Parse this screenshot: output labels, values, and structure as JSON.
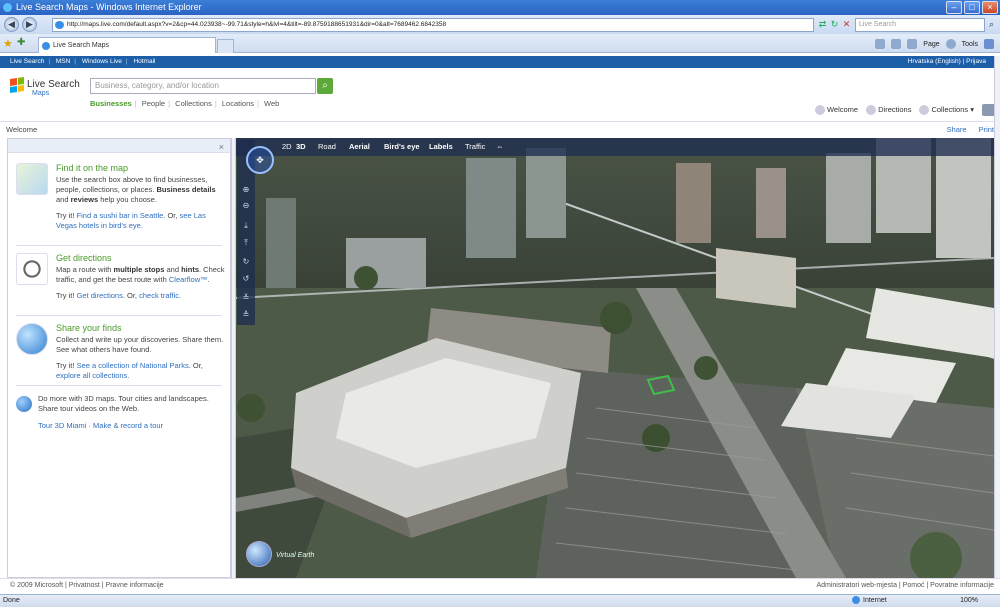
{
  "window": {
    "title": "Live Search Maps - Windows Internet Explorer"
  },
  "address": {
    "url": "http://maps.live.com/default.aspx?v=2&cp=44.023938~-99.71&style=h&lvl=4&tilt=-89.8759188651931&dir=0&alt=7689462.6842358"
  },
  "ie_search": {
    "placeholder": "Live Search"
  },
  "tab": {
    "title": "Live Search Maps"
  },
  "commandbar": {
    "page": "Page",
    "tools": "Tools"
  },
  "toplinks": {
    "items": [
      "Live Search",
      "MSN",
      "Windows Live",
      "Hotmail"
    ],
    "right": "Hrvatska (English) | Prijava"
  },
  "logo": {
    "line1": "Live Search",
    "line2": "Maps"
  },
  "search": {
    "placeholder": "Business, category, and/or location"
  },
  "subnav": {
    "items": [
      "Businesses",
      "People",
      "Collections",
      "Locations",
      "Web"
    ]
  },
  "rightnav": {
    "welcome": "Welcome",
    "directions": "Directions",
    "collections": "Collections"
  },
  "welcomebar": {
    "title": "Welcome",
    "share": "Share",
    "print": "Print"
  },
  "panel": {
    "find": {
      "heading": "Find it on the map",
      "body_pre": "Use the search box above to find businesses, people, collections, or places.",
      "b1": "Business details",
      "and": "and",
      "b2": "reviews",
      "body_post": "help you choose.",
      "try": "Try it!",
      "link1": "Find a sushi bar in Seattle",
      "mid": ". Or,",
      "link2": "see Las Vegas hotels in bird's eye."
    },
    "directions": {
      "heading": "Get directions",
      "p1": "Map a route with",
      "b1": "multiple stops",
      "p2": "and",
      "b2": "hints",
      "p3": ". Check traffic, and get the best route with",
      "link_clearflow": "Clearflow™",
      "p4": ".",
      "try": "Try it!",
      "link1": "Get directions",
      "mid": ". Or,",
      "link2": "check traffic."
    },
    "share": {
      "heading": "Share your finds",
      "body": "Collect and write up your discoveries. Share them. See what others have found.",
      "try": "Try it!",
      "link1": "See a collection of National Parks",
      "mid": ". Or,",
      "link2": "explore all collections."
    },
    "more": {
      "body": "Do more with 3D maps. Tour cities and landscapes. Share tour videos on the Web.",
      "link1": "Tour 3D Miami",
      "sep": "·",
      "link2": "Make & record a tour"
    }
  },
  "maptoolbar": {
    "d2": "2D",
    "d3": "3D",
    "road": "Road",
    "aerial": "Aerial",
    "birdseye": "Bird's eye",
    "labels": "Labels",
    "traffic": "Traffic"
  },
  "map": {
    "brand": "Virtual Earth"
  },
  "footer": {
    "left": "© 2009 Microsoft | Privatnost | Pravne informacije",
    "right": "Administratori web-mjesta | Pomoć | Povratne informacije"
  },
  "status": {
    "left": "Done",
    "zone": "Internet",
    "zoom": "100%"
  }
}
